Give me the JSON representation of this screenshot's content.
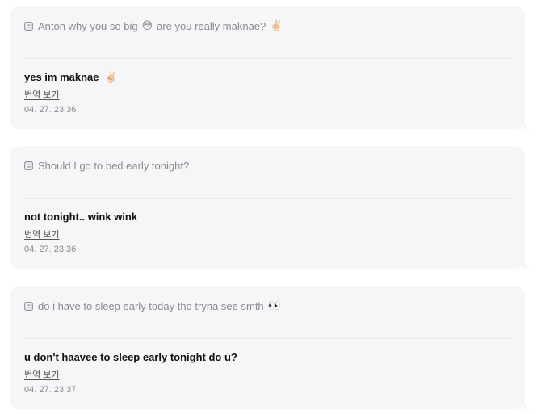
{
  "messages": [
    {
      "question": "Anton why you so big",
      "question_emoji_1": "😳",
      "question_after": "are you really maknae?",
      "question_emoji_2": "✌🏻",
      "answer": "yes im maknae",
      "answer_emoji": "✌🏻",
      "translate_label": "번역 보기",
      "timestamp": "04. 27. 23:36"
    },
    {
      "question": "Should I go to bed early tonight?",
      "answer": "not tonight.. wink wink",
      "translate_label": "번역 보기",
      "timestamp": "04. 27. 23:36"
    },
    {
      "question": "do i have to sleep early today tho tryna see smth",
      "question_emoji_1": "👀",
      "answer": "u don't haavee to sleep early tonight do u?",
      "translate_label": "번역 보기",
      "timestamp": "04. 27. 23:37"
    }
  ]
}
